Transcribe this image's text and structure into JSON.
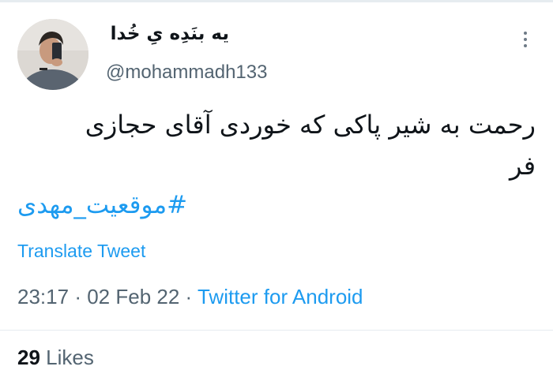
{
  "tweet": {
    "author": {
      "display_name": "یه بنَدِه یِ خُدا",
      "handle": "@mohammadh133"
    },
    "text_line1": "رحمت به شیر پاکی که خوردی آقای حجازی",
    "text_line2": "فر",
    "hashtag": "#موقعیت_مهدی",
    "translate_label": "Translate Tweet",
    "time": "23:17",
    "date": "02 Feb 22",
    "separator": "·",
    "source": "Twitter for Android",
    "likes_count": "29",
    "likes_label": "Likes"
  },
  "icons": {
    "more": "more-vertical-icon",
    "avatar": "avatar-photo"
  },
  "colors": {
    "link": "#1d9bf0",
    "text": "#0f1419",
    "muted": "#536471",
    "divider": "#e6ecf0"
  }
}
